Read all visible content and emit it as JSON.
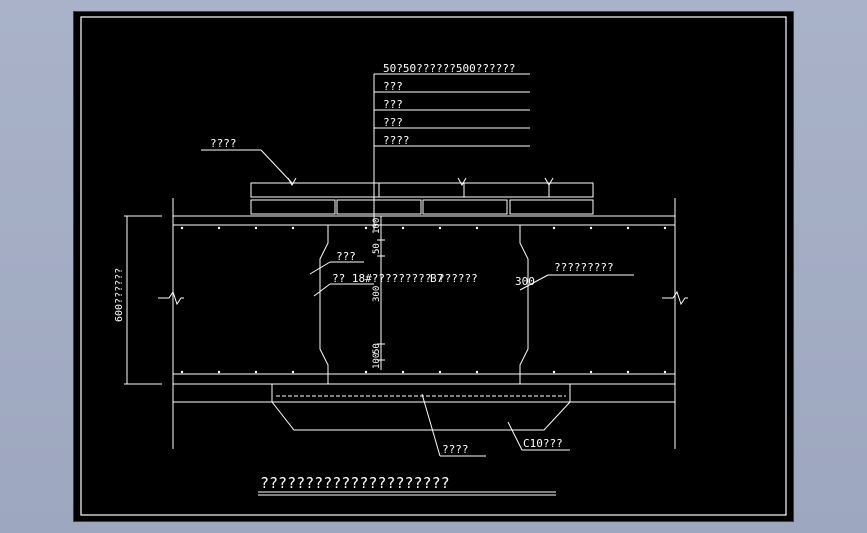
{
  "drawing": {
    "title": "?????????????????????",
    "leader_top_lines": [
      "50?50??????500??????",
      "???",
      "???",
      "???",
      "????"
    ],
    "label_left_top": "????",
    "label_left_mid": "???",
    "label_rebar": "?? 18#????????? ??????",
    "label_rebar_tag": "B7",
    "label_300": "300",
    "label_right": "?????????",
    "label_bottom_mid": "????",
    "label_bottom_right": "C10???",
    "height_dim": "600??????",
    "dims_top": [
      "50",
      "100"
    ],
    "dims_bot": [
      "50",
      "100"
    ],
    "dim_mid": "300"
  },
  "colors": {
    "background": "#000000",
    "lines": "#ffffff",
    "window_bg": "#a7b0c6"
  }
}
